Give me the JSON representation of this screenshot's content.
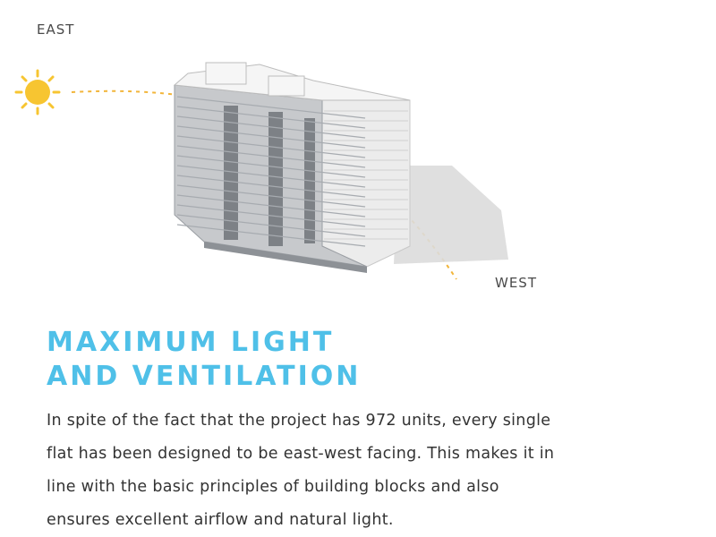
{
  "compass": {
    "east_label": "EAST",
    "west_label": "WEST"
  },
  "illustration": {
    "sun_icon": "sun-icon",
    "building": "residential-tower-illustration",
    "sun_color": "#f7c531",
    "path_color": "#f2b53a"
  },
  "content": {
    "headline_lines": [
      "MAXIMUM LIGHT",
      "AND VENTILATION"
    ],
    "body_lines": [
      "In spite of the fact that the project has 972 units, every single",
      "flat has been designed to be east-west facing. This makes it in",
      "line with the basic principles of building blocks and also",
      "ensures excellent airflow and natural light."
    ]
  },
  "colors": {
    "accent": "#4fc0e8",
    "text": "#333333",
    "label": "#4a4a4a"
  }
}
